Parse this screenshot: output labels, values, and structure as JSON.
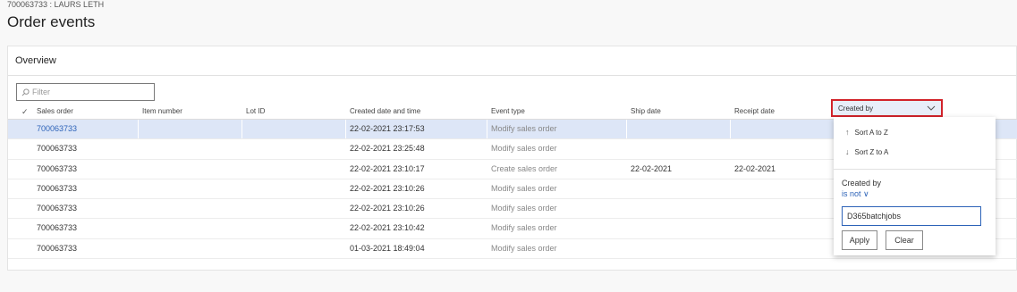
{
  "record": {
    "caption": "700063733 : LAURS LETH"
  },
  "page": {
    "title": "Order events"
  },
  "panel": {
    "title": "Overview"
  },
  "filter": {
    "placeholder": "Filter",
    "value": ""
  },
  "grid": {
    "columns": [
      "Sales order",
      "Item number",
      "Lot ID",
      "Created date and time",
      "Event type",
      "Ship date",
      "Receipt date",
      "Created by"
    ],
    "rows": [
      {
        "sales_order": "700063733",
        "item_number": "",
        "lot_id": "",
        "created": "22-02-2021 23:17:53",
        "event_type": "Modify sales order",
        "ship_date": "",
        "receipt_date": "",
        "selected": true
      },
      {
        "sales_order": "700063733",
        "item_number": "",
        "lot_id": "",
        "created": "22-02-2021 23:25:48",
        "event_type": "Modify sales order",
        "ship_date": "",
        "receipt_date": "",
        "selected": false
      },
      {
        "sales_order": "700063733",
        "item_number": "",
        "lot_id": "",
        "created": "22-02-2021 23:10:17",
        "event_type": "Create sales order",
        "ship_date": "22-02-2021",
        "receipt_date": "22-02-2021",
        "selected": false
      },
      {
        "sales_order": "700063733",
        "item_number": "",
        "lot_id": "",
        "created": "22-02-2021 23:10:26",
        "event_type": "Modify sales order",
        "ship_date": "",
        "receipt_date": "",
        "selected": false
      },
      {
        "sales_order": "700063733",
        "item_number": "",
        "lot_id": "",
        "created": "22-02-2021 23:10:26",
        "event_type": "Modify sales order",
        "ship_date": "",
        "receipt_date": "",
        "selected": false
      },
      {
        "sales_order": "700063733",
        "item_number": "",
        "lot_id": "",
        "created": "22-02-2021 23:10:42",
        "event_type": "Modify sales order",
        "ship_date": "",
        "receipt_date": "",
        "selected": false
      },
      {
        "sales_order": "700063733",
        "item_number": "",
        "lot_id": "",
        "created": "01-03-2021 18:49:04",
        "event_type": "Modify sales order",
        "ship_date": "",
        "receipt_date": "",
        "selected": false
      }
    ]
  },
  "column_menu": {
    "sort_asc": "Sort A to Z",
    "sort_desc": "Sort Z to A",
    "filter_label": "Created by",
    "operator": "is not",
    "filter_value": "D365batchjobs",
    "apply_label": "Apply",
    "clear_label": "Clear"
  },
  "colors": {
    "accent": "#2d63b8",
    "selected_row": "#dde6f7",
    "highlight_border": "#d2232a"
  }
}
